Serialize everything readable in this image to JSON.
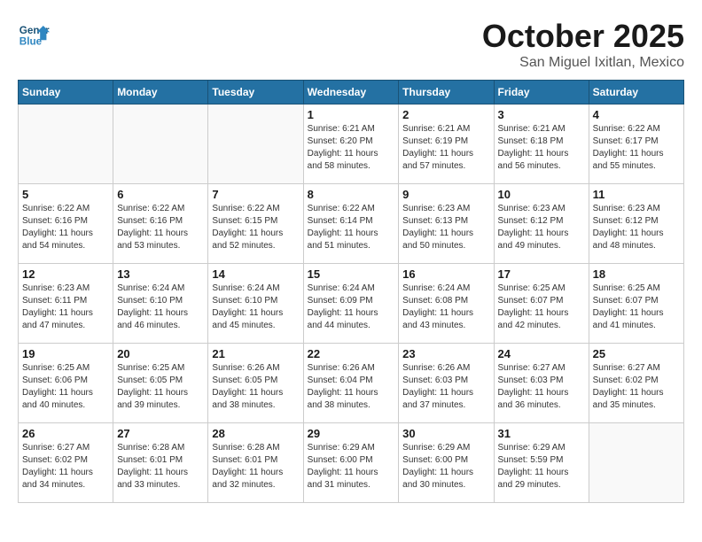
{
  "logo": {
    "text1": "General",
    "text2": "Blue"
  },
  "header": {
    "month": "October 2025",
    "location": "San Miguel Ixitlan, Mexico"
  },
  "weekdays": [
    "Sunday",
    "Monday",
    "Tuesday",
    "Wednesday",
    "Thursday",
    "Friday",
    "Saturday"
  ],
  "weeks": [
    [
      {
        "day": "",
        "info": ""
      },
      {
        "day": "",
        "info": ""
      },
      {
        "day": "",
        "info": ""
      },
      {
        "day": "1",
        "info": "Sunrise: 6:21 AM\nSunset: 6:20 PM\nDaylight: 11 hours\nand 58 minutes."
      },
      {
        "day": "2",
        "info": "Sunrise: 6:21 AM\nSunset: 6:19 PM\nDaylight: 11 hours\nand 57 minutes."
      },
      {
        "day": "3",
        "info": "Sunrise: 6:21 AM\nSunset: 6:18 PM\nDaylight: 11 hours\nand 56 minutes."
      },
      {
        "day": "4",
        "info": "Sunrise: 6:22 AM\nSunset: 6:17 PM\nDaylight: 11 hours\nand 55 minutes."
      }
    ],
    [
      {
        "day": "5",
        "info": "Sunrise: 6:22 AM\nSunset: 6:16 PM\nDaylight: 11 hours\nand 54 minutes."
      },
      {
        "day": "6",
        "info": "Sunrise: 6:22 AM\nSunset: 6:16 PM\nDaylight: 11 hours\nand 53 minutes."
      },
      {
        "day": "7",
        "info": "Sunrise: 6:22 AM\nSunset: 6:15 PM\nDaylight: 11 hours\nand 52 minutes."
      },
      {
        "day": "8",
        "info": "Sunrise: 6:22 AM\nSunset: 6:14 PM\nDaylight: 11 hours\nand 51 minutes."
      },
      {
        "day": "9",
        "info": "Sunrise: 6:23 AM\nSunset: 6:13 PM\nDaylight: 11 hours\nand 50 minutes."
      },
      {
        "day": "10",
        "info": "Sunrise: 6:23 AM\nSunset: 6:12 PM\nDaylight: 11 hours\nand 49 minutes."
      },
      {
        "day": "11",
        "info": "Sunrise: 6:23 AM\nSunset: 6:12 PM\nDaylight: 11 hours\nand 48 minutes."
      }
    ],
    [
      {
        "day": "12",
        "info": "Sunrise: 6:23 AM\nSunset: 6:11 PM\nDaylight: 11 hours\nand 47 minutes."
      },
      {
        "day": "13",
        "info": "Sunrise: 6:24 AM\nSunset: 6:10 PM\nDaylight: 11 hours\nand 46 minutes."
      },
      {
        "day": "14",
        "info": "Sunrise: 6:24 AM\nSunset: 6:10 PM\nDaylight: 11 hours\nand 45 minutes."
      },
      {
        "day": "15",
        "info": "Sunrise: 6:24 AM\nSunset: 6:09 PM\nDaylight: 11 hours\nand 44 minutes."
      },
      {
        "day": "16",
        "info": "Sunrise: 6:24 AM\nSunset: 6:08 PM\nDaylight: 11 hours\nand 43 minutes."
      },
      {
        "day": "17",
        "info": "Sunrise: 6:25 AM\nSunset: 6:07 PM\nDaylight: 11 hours\nand 42 minutes."
      },
      {
        "day": "18",
        "info": "Sunrise: 6:25 AM\nSunset: 6:07 PM\nDaylight: 11 hours\nand 41 minutes."
      }
    ],
    [
      {
        "day": "19",
        "info": "Sunrise: 6:25 AM\nSunset: 6:06 PM\nDaylight: 11 hours\nand 40 minutes."
      },
      {
        "day": "20",
        "info": "Sunrise: 6:25 AM\nSunset: 6:05 PM\nDaylight: 11 hours\nand 39 minutes."
      },
      {
        "day": "21",
        "info": "Sunrise: 6:26 AM\nSunset: 6:05 PM\nDaylight: 11 hours\nand 38 minutes."
      },
      {
        "day": "22",
        "info": "Sunrise: 6:26 AM\nSunset: 6:04 PM\nDaylight: 11 hours\nand 38 minutes."
      },
      {
        "day": "23",
        "info": "Sunrise: 6:26 AM\nSunset: 6:03 PM\nDaylight: 11 hours\nand 37 minutes."
      },
      {
        "day": "24",
        "info": "Sunrise: 6:27 AM\nSunset: 6:03 PM\nDaylight: 11 hours\nand 36 minutes."
      },
      {
        "day": "25",
        "info": "Sunrise: 6:27 AM\nSunset: 6:02 PM\nDaylight: 11 hours\nand 35 minutes."
      }
    ],
    [
      {
        "day": "26",
        "info": "Sunrise: 6:27 AM\nSunset: 6:02 PM\nDaylight: 11 hours\nand 34 minutes."
      },
      {
        "day": "27",
        "info": "Sunrise: 6:28 AM\nSunset: 6:01 PM\nDaylight: 11 hours\nand 33 minutes."
      },
      {
        "day": "28",
        "info": "Sunrise: 6:28 AM\nSunset: 6:01 PM\nDaylight: 11 hours\nand 32 minutes."
      },
      {
        "day": "29",
        "info": "Sunrise: 6:29 AM\nSunset: 6:00 PM\nDaylight: 11 hours\nand 31 minutes."
      },
      {
        "day": "30",
        "info": "Sunrise: 6:29 AM\nSunset: 6:00 PM\nDaylight: 11 hours\nand 30 minutes."
      },
      {
        "day": "31",
        "info": "Sunrise: 6:29 AM\nSunset: 5:59 PM\nDaylight: 11 hours\nand 29 minutes."
      },
      {
        "day": "",
        "info": ""
      }
    ]
  ]
}
